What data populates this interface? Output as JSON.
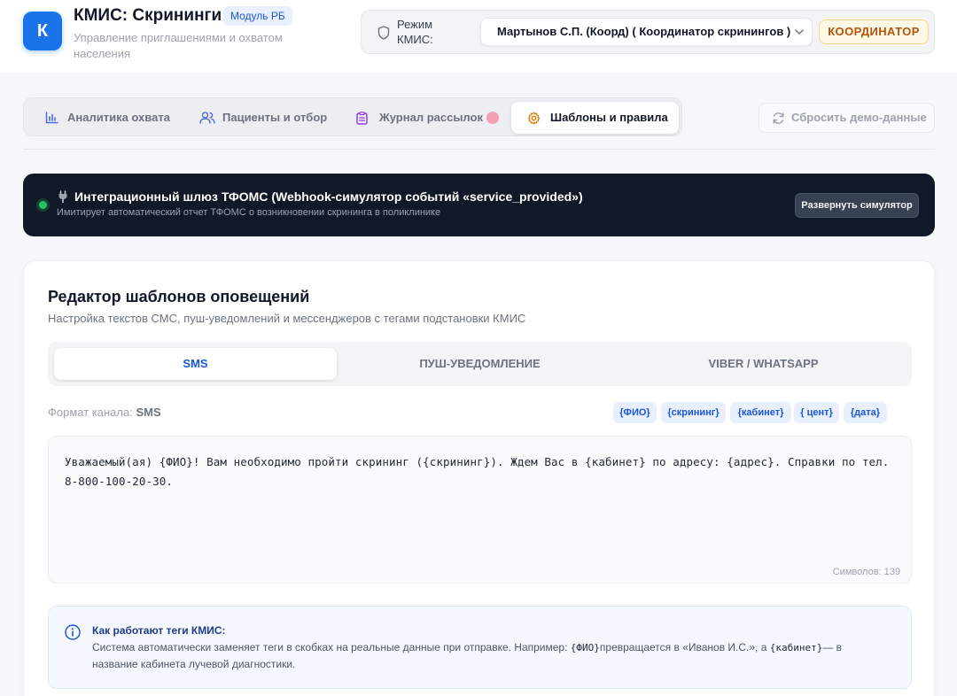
{
  "app": {
    "logo_letter": "К",
    "title": "КМИС: Скрининги",
    "module_badge": "Модуль РБ",
    "subtitle": "Управление приглашениями и охватом населения"
  },
  "mode": {
    "label": "Режим КМИС:",
    "selected_user": "Мартынов С.П. (Коорд) ( Координатор скринингов )",
    "role_badge": "КООРДИНАТОР"
  },
  "tabs": [
    {
      "label": "Аналитика охвата",
      "icon": "bar-chart-icon",
      "active": false
    },
    {
      "label": "Пациенты и отбор",
      "icon": "users-icon",
      "active": false
    },
    {
      "label": "Журнал рассылок",
      "icon": "clipboard-icon",
      "active": false
    },
    {
      "label": "Шаблоны и правила",
      "icon": "gear-icon",
      "active": true
    }
  ],
  "reset_button": "Сбросить демо-данные",
  "gateway": {
    "icon": "plug-icon",
    "title": "Интеграционный шлюз ТФОМС (Webhook-симулятор событий «service_provided»)",
    "subtitle": "Имитирует автоматический отчет ТФОМС о возникновении скрининга в поликлинике",
    "button": "Развернуть симулятор",
    "status_color": "#22c55e"
  },
  "editor_card": {
    "title": "Редактор шаблонов оповещений",
    "subtitle": "Настройка текстов СМС, пуш-уведомлений и мессенджеров с тегами подстановки КМИС",
    "channel_tabs": [
      {
        "label": "SMS",
        "active": true
      },
      {
        "label": "ПУШ-УВЕДОМЛЕНИЕ",
        "active": false
      },
      {
        "label": "VIBER / WHATSAPP",
        "active": false
      }
    ],
    "format_label": "Формат канала:",
    "format_value": "SMS",
    "tags": [
      "{ФИО}",
      "{скрининг}",
      "{кабинет}",
      "{ цент}",
      "{дата}"
    ],
    "template_text": "Уважаемый(ая) {ФИО}! Вам необходимо пройти скрининг ({скрининг}). Ждем Вас в {кабинет} по адресу: {адрес}. Справки по тел. 8-800-100-20-30.",
    "char_count": "Символов: 139"
  },
  "info": {
    "title": "Как работают теги КМИС:",
    "text_before": "Система автоматически заменяет теги в скобках на реальные данные при отправке. Например: ",
    "tag1": "{ФИО}",
    "text_middle": "превращается в «Иванов И.С.», а ",
    "tag2": "{кабинет}",
    "text_after": "— в название кабинета лучевой диагностики."
  },
  "colors": {
    "accent": "#1a73e8",
    "role_badge": "#b45309",
    "gateway_bg": "#111827"
  }
}
